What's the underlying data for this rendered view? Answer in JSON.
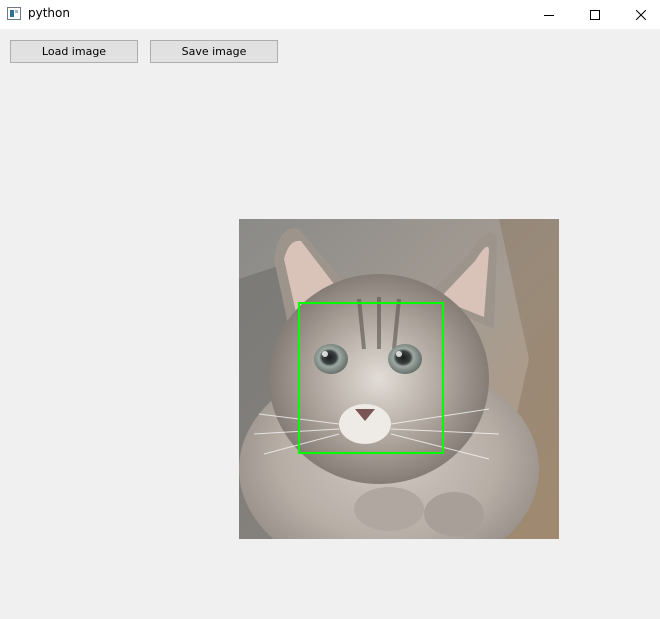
{
  "window": {
    "title": "python",
    "icon": "app-window-icon"
  },
  "caption_buttons": {
    "minimize_icon": "minimize-icon",
    "maximize_icon": "maximize-icon",
    "close_icon": "close-icon"
  },
  "toolbar": {
    "load_label": "Load image",
    "save_label": "Save image"
  },
  "image": {
    "subject": "cat photo",
    "detection_box_color": "#00ff00"
  }
}
